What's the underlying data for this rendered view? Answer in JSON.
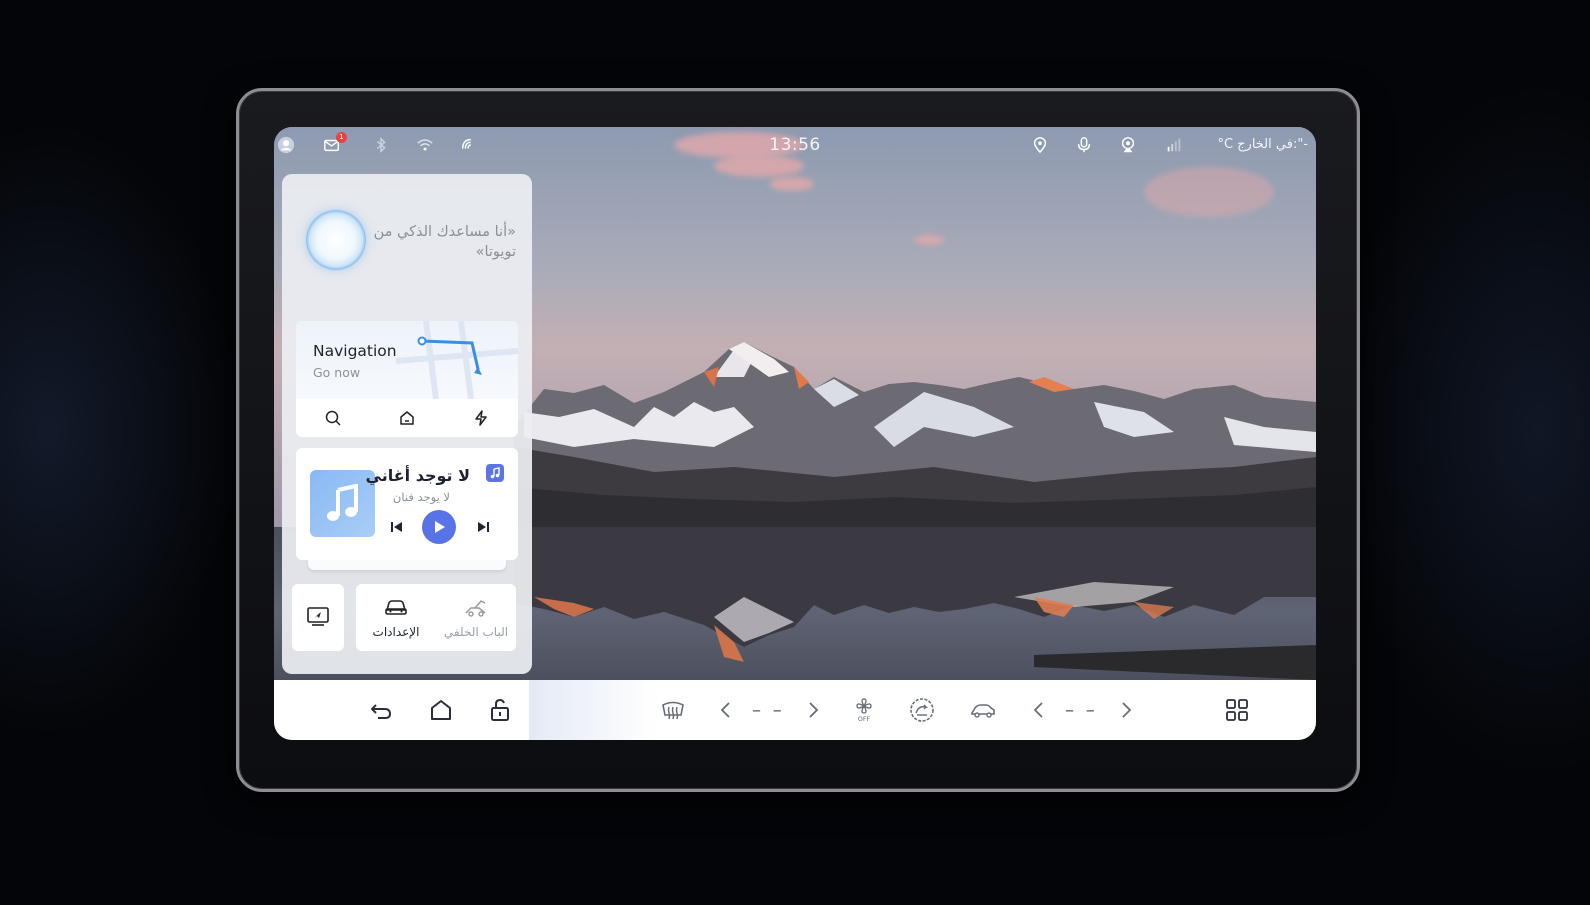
{
  "status_bar": {
    "time": "13:56",
    "outside_temp": "°C في الخارج:\"-",
    "mail_badge": "1",
    "left_icons": [
      "user-icon",
      "mail-icon",
      "bluetooth-icon",
      "wifi-icon",
      "hotspot-icon"
    ],
    "right_icons": [
      "location-icon",
      "microphone-icon",
      "camera-icon",
      "signal-icon"
    ]
  },
  "assistant": {
    "greeting": "«أنا مساعدك الذكي من تويوتا»"
  },
  "navigation": {
    "title": "Navigation",
    "subtitle": "Go now",
    "actions": [
      "search-icon",
      "home-icon",
      "charging-icon"
    ]
  },
  "media": {
    "song": "لا توجد أغاني",
    "artist": "لا يوجد فنان",
    "controls": [
      "previous-icon",
      "play-icon",
      "next-icon"
    ]
  },
  "quick_tiles": {
    "screen_label": "",
    "settings": "الإعدادات",
    "rear_door": "الباب الخلفي"
  },
  "dock": {
    "left_temp": "– –",
    "right_temp": "– –",
    "fan_status": "OFF"
  },
  "colors": {
    "accent": "#5873e8",
    "panel_bg": "#eceef2",
    "dock_bg": "#ffffff"
  }
}
